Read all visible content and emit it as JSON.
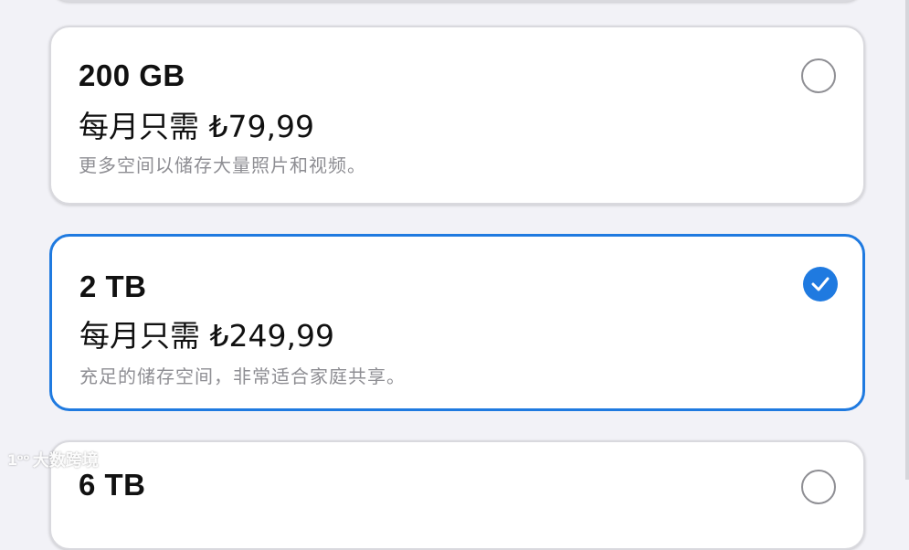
{
  "plans": [
    {
      "size": "200 GB",
      "price": "每月只需 ₺79,99",
      "description": "更多空间以储存大量照片和视频。",
      "selected": false
    },
    {
      "size": "2 TB",
      "price": "每月只需 ₺249,99",
      "description": "充足的储存空间，非常适合家庭共享。",
      "selected": true
    },
    {
      "size": "6 TB",
      "selected": false
    }
  ],
  "watermark": {
    "logo": "1ᵒᵒ",
    "text": "大数跨境"
  },
  "colors": {
    "accent": "#1f7ae0",
    "secondary_text": "#8e8e93",
    "background": "#f2f2f7"
  }
}
